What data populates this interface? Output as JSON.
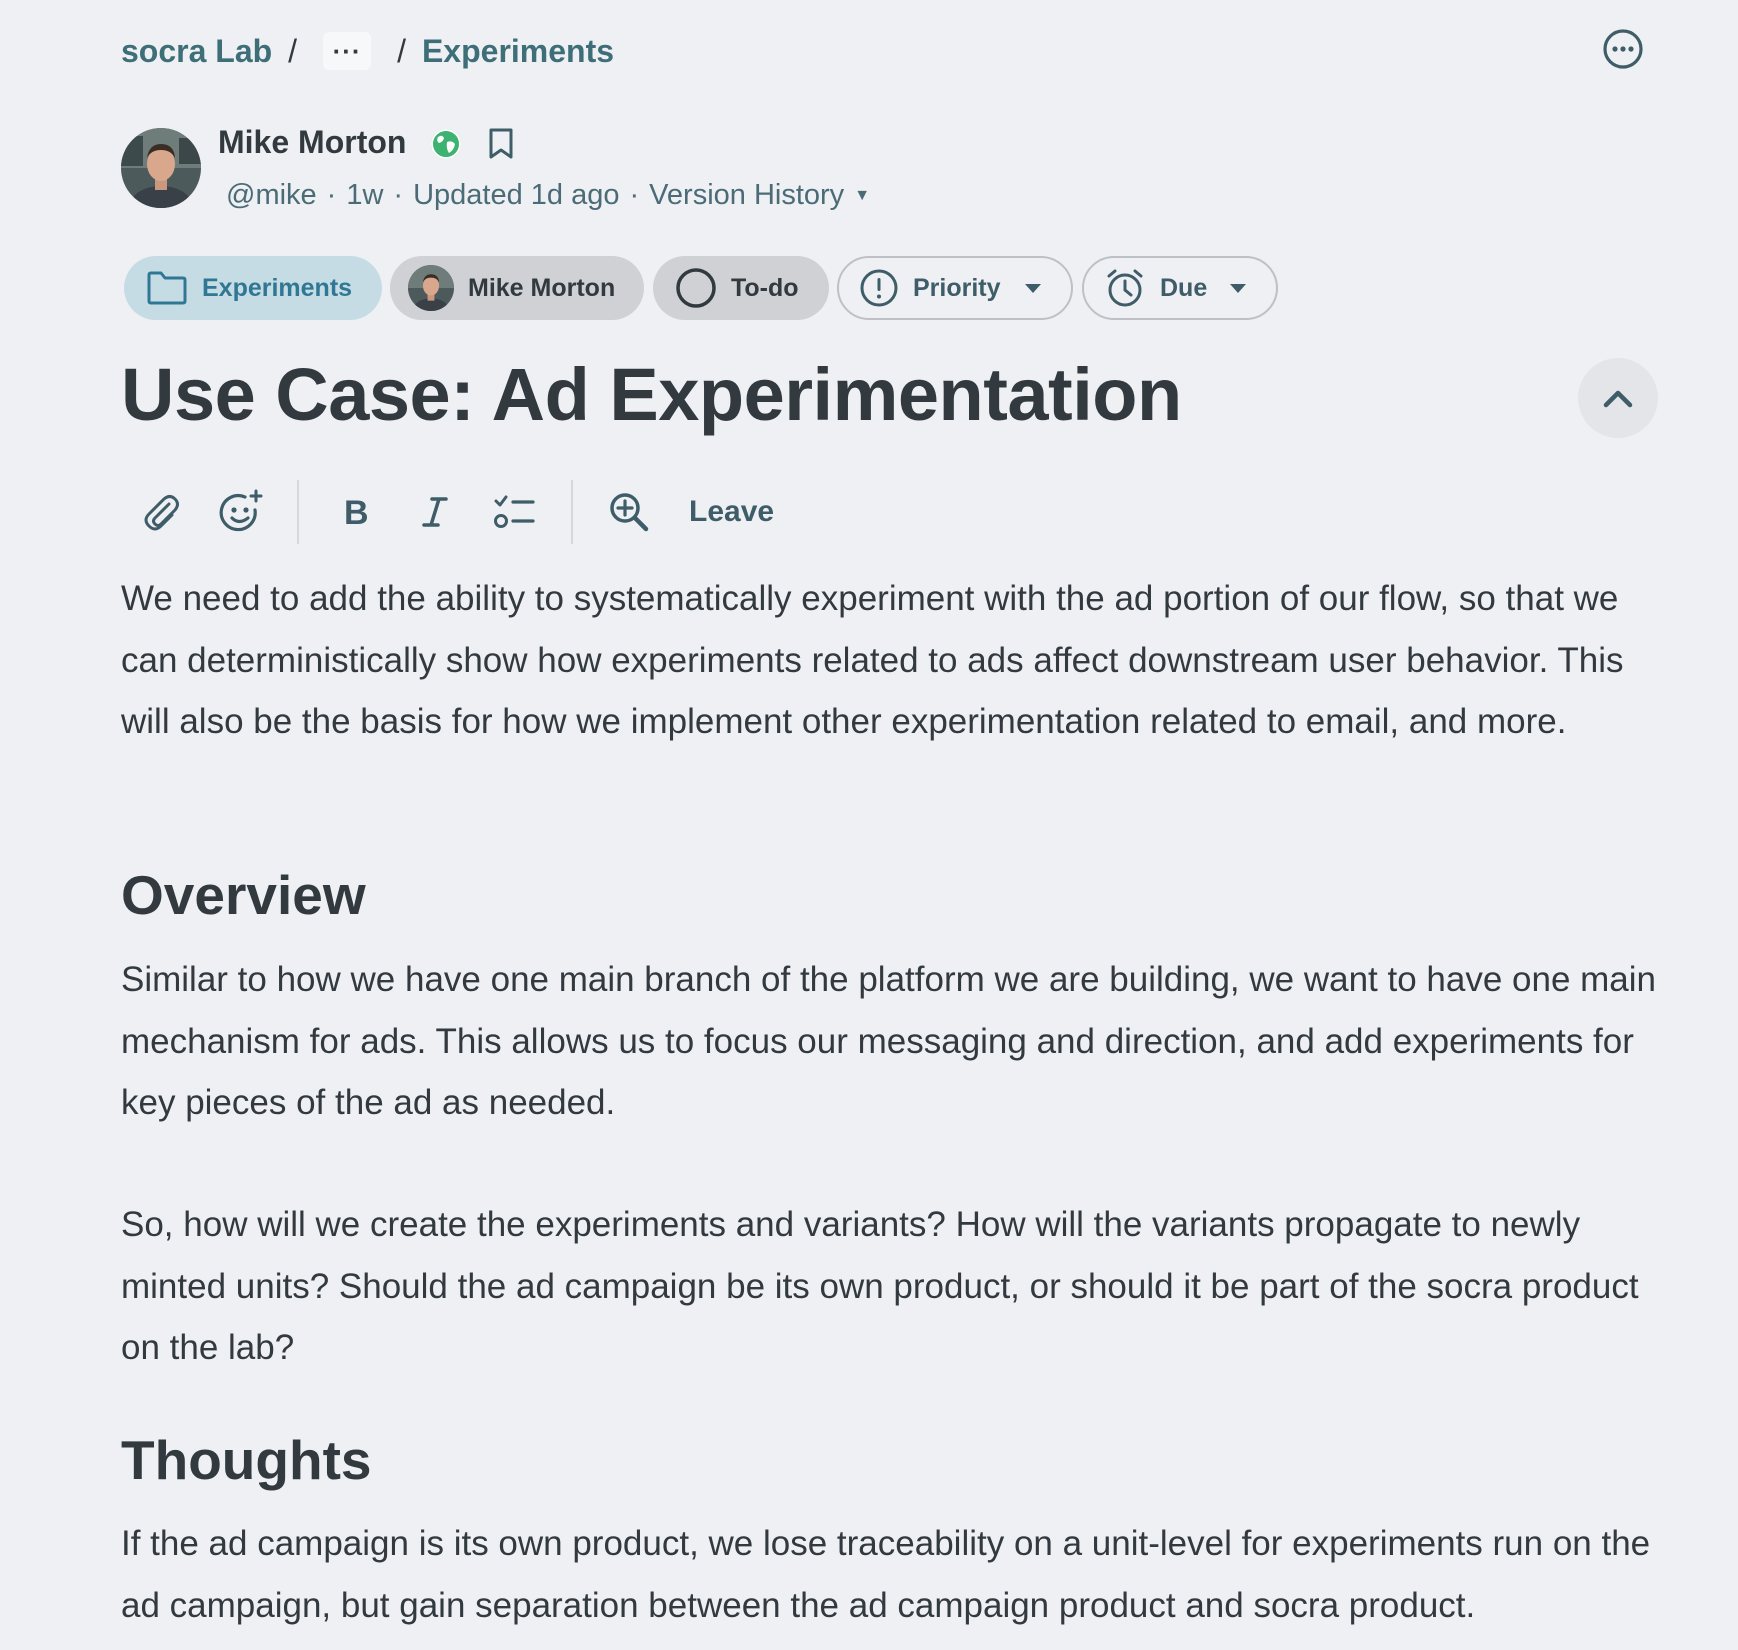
{
  "breadcrumb": {
    "workspace": "socra Lab",
    "separator": "/",
    "ellipsis": "···",
    "current": "Experiments"
  },
  "author": {
    "name": "Mike Morton",
    "handle": "@mike",
    "created": "1w",
    "updated": "Updated 1d ago",
    "version_history": "Version History",
    "dot": "·"
  },
  "chips": {
    "folder": "Experiments",
    "assignee": "Mike Morton",
    "status": "To-do",
    "priority": "Priority",
    "due": "Due"
  },
  "doc": {
    "title": "Use Case: Ad Experimentation"
  },
  "toolbar": {
    "leave": "Leave"
  },
  "body": {
    "intro": "We need to add the ability to systematically experiment with the ad portion of our flow, so that we can deterministically show how experiments related to ads affect downstream user behavior. This will also be the basis for how we implement other experimentation related to email, and more.",
    "overview_heading": "Overview",
    "overview_p1": "Similar to how we have one main branch of the platform we are building, we want to have one main mechanism for ads. This allows us to focus our messaging and direction, and add experiments for key pieces of the ad as needed.",
    "overview_p2": "So, how will we create the experiments and variants? How will the variants propagate to newly minted units? Should the ad campaign be its own product, or should it be part of the socra product on the lab?",
    "thoughts_heading": "Thoughts",
    "thoughts_p1": "If the ad campaign is its own product, we lose traceability on a unit-level for experiments run on the ad campaign, but gain separation between the ad campaign product and socra product."
  },
  "colors": {
    "background": "#eff0f3",
    "text": "#323a40",
    "link": "#3e6f79",
    "chip_folder_bg": "#c6dce4",
    "chip_folder_text": "#2f7792",
    "globe": "#3cb371"
  }
}
